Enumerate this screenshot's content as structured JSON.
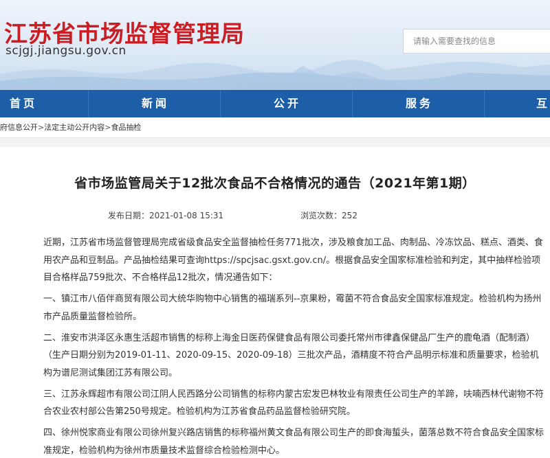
{
  "header": {
    "title_cn": "江苏省市场监督管理局",
    "domain": "scjgj.jiangsu.gov.cn",
    "search_placeholder": "请输入需要查找的信息"
  },
  "nav": {
    "items": [
      "首页",
      "新闻",
      "公开",
      "服务",
      "互"
    ]
  },
  "breadcrumb": {
    "items": [
      "府信息公开",
      "法定主动公开内容",
      "食品抽检"
    ],
    "separator": ">"
  },
  "article": {
    "title": "省市场监管局关于12批次食品不合格情况的通告（2021年第1期）",
    "publish_label": "发布日期：",
    "publish_date": "2021-01-08 15:31",
    "views_label": "浏览次数：",
    "views": "252",
    "paragraphs": [
      "近期，江苏省市场监督管理局完成省级食品安全监督抽检任务771批次，涉及粮食加工品、肉制品、冷冻饮品、糕点、酒类、食用农产品和豆制品。产品抽检结果可查询https://spcjsac.gsxt.gov.cn/。根据食品安全国家标准检验和判定，其中抽样检验项目合格样品759批次、不合格样品12批次，情况通告如下：",
      "一、镇江市八佰伴商贸有限公司大统华购物中心销售的福瑞系列--京果粉，霉菌不符合食品安全国家标准规定。检验机构为扬州市产品质量监督检验所。",
      "二、淮安市洪泽区永惠生活超市销售的标称上海金日医药保健食品有限公司委托常州市律鑫保健品厂生产的鹿龟酒（配制酒）（生产日期分别为2019-01-11、2020-09-15、2020-09-18）三批次产品，酒精度不符合产品明示标准和质量要求，检验机构为谱尼测试集团江苏有限公司。",
      "三、江苏永辉超市有限公司江阴人民西路分公司销售的标称内蒙古宏发巴林牧业有限责任公司生产的羊蹄，呋喃西林代谢物不符合农业农村部公告第250号规定。检验机构为江苏省食品药品监督检验研究院。",
      "四、徐州悦家商业有限公司徐州复兴路店销售的标称福州黄文食品有限公司生产的即食海蜇头，菌落总数不符合食品安全国家标准规定，检验机构为徐州市质量技术监督综合检验检测中心。"
    ]
  }
}
